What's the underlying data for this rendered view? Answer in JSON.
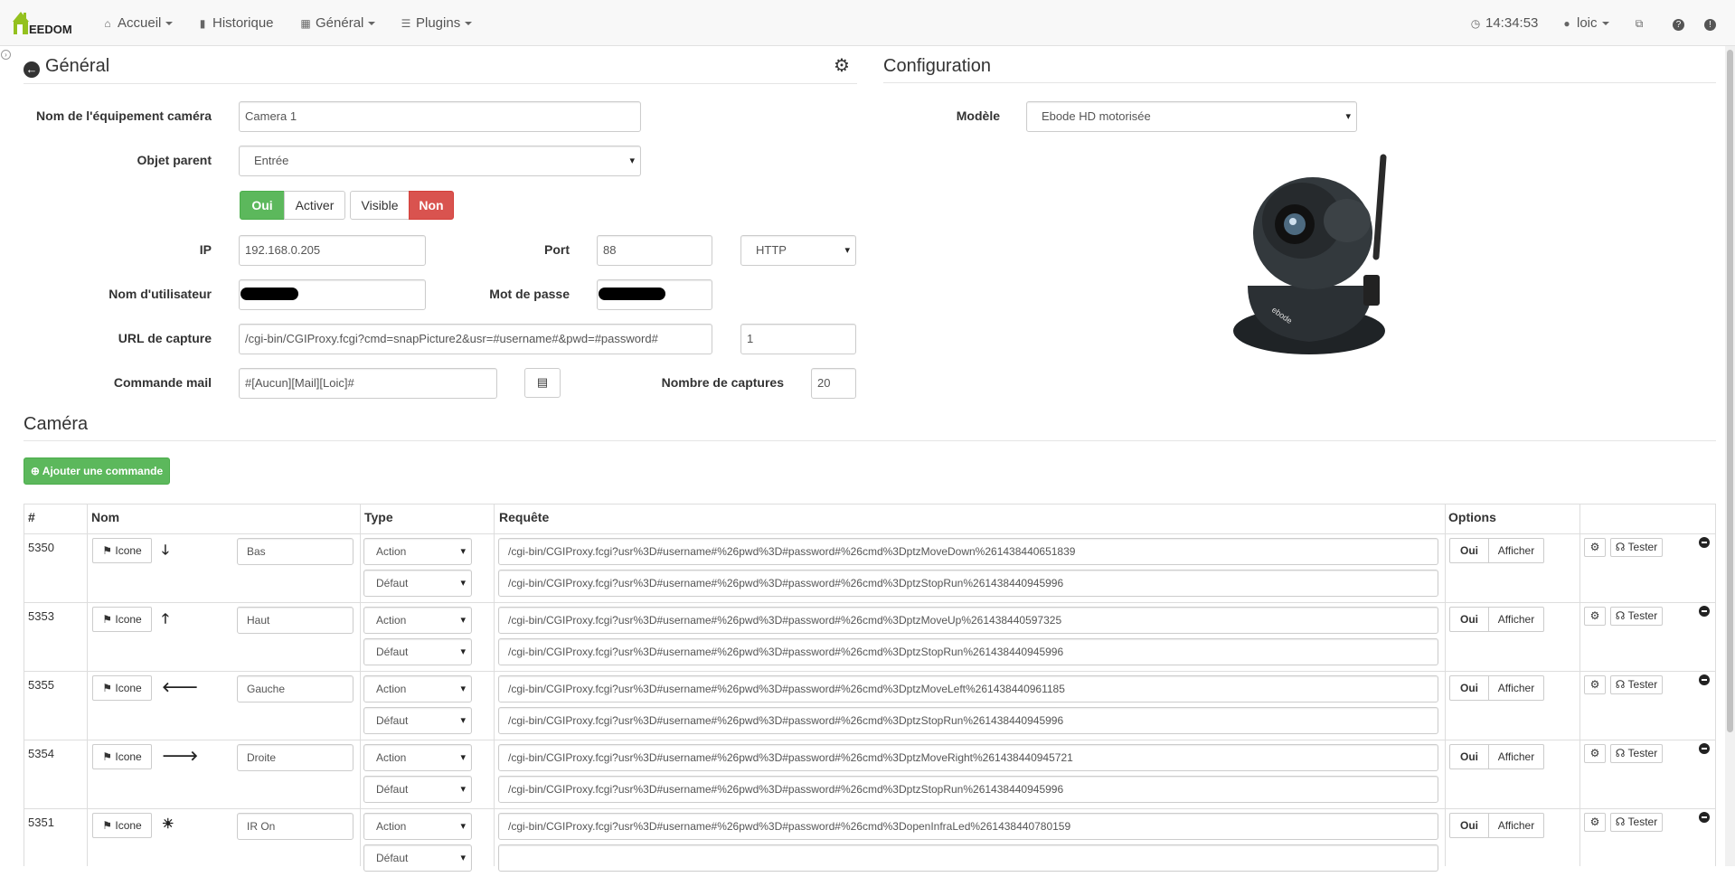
{
  "nav": {
    "brand": "EEDOM",
    "accueil": "Accueil",
    "historique": "Historique",
    "general": "Général",
    "plugins": "Plugins",
    "time": "14:34:53",
    "user": "loic"
  },
  "general": {
    "title": "Général",
    "label_name": "Nom de l'équipement caméra",
    "name_value": "Camera 1",
    "label_parent": "Objet parent",
    "parent_value": "Entrée",
    "btn_oui": "Oui",
    "btn_activer": "Activer",
    "btn_visible": "Visible",
    "btn_non": "Non",
    "label_ip": "IP",
    "ip_value": "192.168.0.205",
    "label_port": "Port",
    "port_value": "88",
    "protocol_value": "HTTP",
    "label_user": "Nom d'utilisateur",
    "label_pass": "Mot de passe",
    "label_url": "URL de capture",
    "url_value": "/cgi-bin/CGIProxy.fcgi?cmd=snapPicture2&usr=#username#&pwd=#password#",
    "url_extra": "1",
    "label_mail": "Commande mail",
    "mail_value": "#[Aucun][Mail][Loic]#",
    "label_captures": "Nombre de captures",
    "captures_value": "20"
  },
  "config": {
    "title": "Configuration",
    "label_model": "Modèle",
    "model_value": "Ebode HD motorisée"
  },
  "camera": {
    "title": "Caméra",
    "add_button": "Ajouter une commande",
    "headers": {
      "id": "#",
      "nom": "Nom",
      "type": "Type",
      "requete": "Requête",
      "options": "Options"
    },
    "icon_label": "Icone",
    "oui": "Oui",
    "afficher": "Afficher",
    "tester": "Tester",
    "rows": [
      {
        "id": "5350",
        "name": "Bas",
        "arrow": "🡓",
        "type1": "Action",
        "type2": "Défaut",
        "req1": "/cgi-bin/CGIProxy.fcgi?usr%3D#username#%26pwd%3D#password#%26cmd%3DptzMoveDown%261438440651839",
        "req2": "/cgi-bin/CGIProxy.fcgi?usr%3D#username#%26pwd%3D#password#%26cmd%3DptzStopRun%261438440945996"
      },
      {
        "id": "5353",
        "name": "Haut",
        "arrow": "🡑",
        "type1": "Action",
        "type2": "Défaut",
        "req1": "/cgi-bin/CGIProxy.fcgi?usr%3D#username#%26pwd%3D#password#%26cmd%3DptzMoveUp%261438440597325",
        "req2": "/cgi-bin/CGIProxy.fcgi?usr%3D#username#%26pwd%3D#password#%26cmd%3DptzStopRun%261438440945996"
      },
      {
        "id": "5355",
        "name": "Gauche",
        "arrow": "🡐",
        "type1": "Action",
        "type2": "Défaut",
        "req1": "/cgi-bin/CGIProxy.fcgi?usr%3D#username#%26pwd%3D#password#%26cmd%3DptzMoveLeft%261438440961185",
        "req2": "/cgi-bin/CGIProxy.fcgi?usr%3D#username#%26pwd%3D#password#%26cmd%3DptzStopRun%261438440945996"
      },
      {
        "id": "5354",
        "name": "Droite",
        "arrow": "🡒",
        "type1": "Action",
        "type2": "Défaut",
        "req1": "/cgi-bin/CGIProxy.fcgi?usr%3D#username#%26pwd%3D#password#%26cmd%3DptzMoveRight%261438440945721",
        "req2": "/cgi-bin/CGIProxy.fcgi?usr%3D#username#%26pwd%3D#password#%26cmd%3DptzStopRun%261438440945996"
      },
      {
        "id": "5351",
        "name": "IR On",
        "arrow": "☀",
        "type1": "Action",
        "type2": "Défaut",
        "req1": "/cgi-bin/CGIProxy.fcgi?usr%3D#username#%26pwd%3D#password#%26cmd%3DopenInfraLed%261438440780159",
        "req2": ""
      }
    ]
  }
}
